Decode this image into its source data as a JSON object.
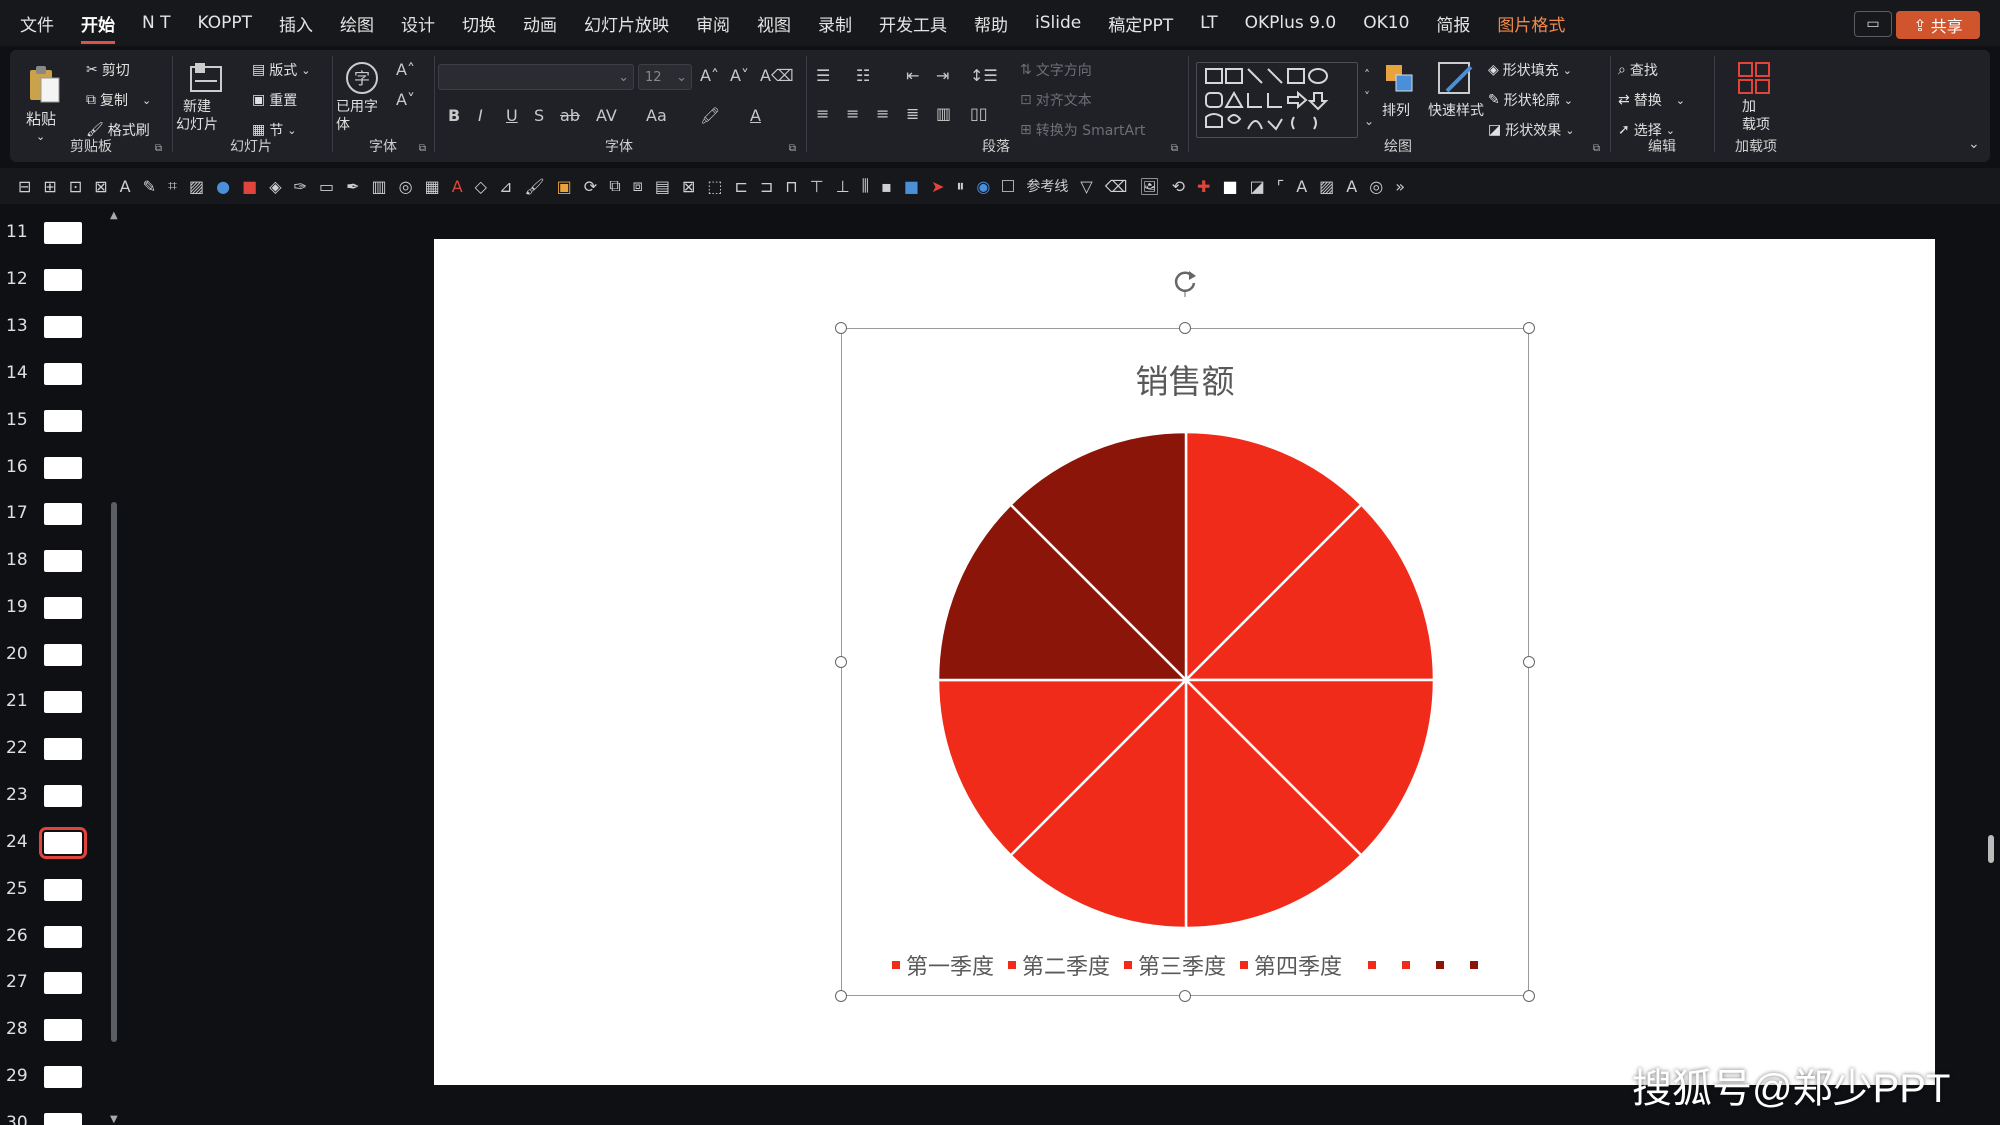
{
  "menu": {
    "items": [
      "文件",
      "开始",
      "N T",
      "KOPPT",
      "插入",
      "绘图",
      "设计",
      "切换",
      "动画",
      "幻灯片放映",
      "审阅",
      "视图",
      "录制",
      "开发工具",
      "帮助",
      "iSlide",
      "稿定PPT",
      "LT",
      "OKPlus 9.0",
      "OK10",
      "简报",
      "图片格式"
    ],
    "active_index": 1,
    "contextual_index": 21,
    "share_label": "共享"
  },
  "ribbon": {
    "clipboard": {
      "paste": "粘贴",
      "cut": "剪切",
      "copy": "复制",
      "format_painter": "格式刷",
      "label": "剪贴板"
    },
    "slides": {
      "new_slide": "新建\n幻灯片",
      "layout": "版式",
      "reset": "重置",
      "section": "节",
      "label": "幻灯片"
    },
    "font_used": {
      "used_fonts": "已用字\n体",
      "label": "字体"
    },
    "font": {
      "font_size": "12",
      "label": "字体"
    },
    "paragraph": {
      "text_direction": "文字方向",
      "align_text": "对齐文本",
      "convert_smartart": "转换为 SmartArt",
      "label": "段落"
    },
    "drawing": {
      "arrange": "排列",
      "quick_styles": "快速样式",
      "shape_fill": "形状填充",
      "shape_outline": "形状轮廓",
      "shape_effects": "形状效果",
      "label": "绘图"
    },
    "editing": {
      "find": "查找",
      "replace": "替换",
      "select": "选择",
      "label": "编辑"
    },
    "addins": {
      "addins": "加\n载项",
      "label": "加载项"
    }
  },
  "qat": {
    "guides_label": "参考线"
  },
  "thumbnails": [
    {
      "num": "11"
    },
    {
      "num": "12"
    },
    {
      "num": "13"
    },
    {
      "num": "14"
    },
    {
      "num": "15"
    },
    {
      "num": "16"
    },
    {
      "num": "17"
    },
    {
      "num": "18"
    },
    {
      "num": "19"
    },
    {
      "num": "20"
    },
    {
      "num": "21"
    },
    {
      "num": "22"
    },
    {
      "num": "23"
    },
    {
      "num": "24",
      "selected": true
    },
    {
      "num": "25"
    },
    {
      "num": "26"
    },
    {
      "num": "27"
    },
    {
      "num": "28"
    },
    {
      "num": "29"
    },
    {
      "num": "30"
    }
  ],
  "chart_data": {
    "type": "pie",
    "title": "销售额",
    "categories": [
      "第一季度",
      "第二季度",
      "第三季度",
      "第四季度",
      "",
      "",
      "",
      ""
    ],
    "values": [
      1,
      1,
      1,
      1,
      1,
      1,
      1,
      1
    ],
    "colors": [
      "#f12b1a",
      "#f12b1a",
      "#f12b1a",
      "#f12b1a",
      "#f12b1a",
      "#f12b1a",
      "#8b1508",
      "#8b1508"
    ],
    "legend": "bottom"
  },
  "watermark": "搜狐号@郑少PPT"
}
